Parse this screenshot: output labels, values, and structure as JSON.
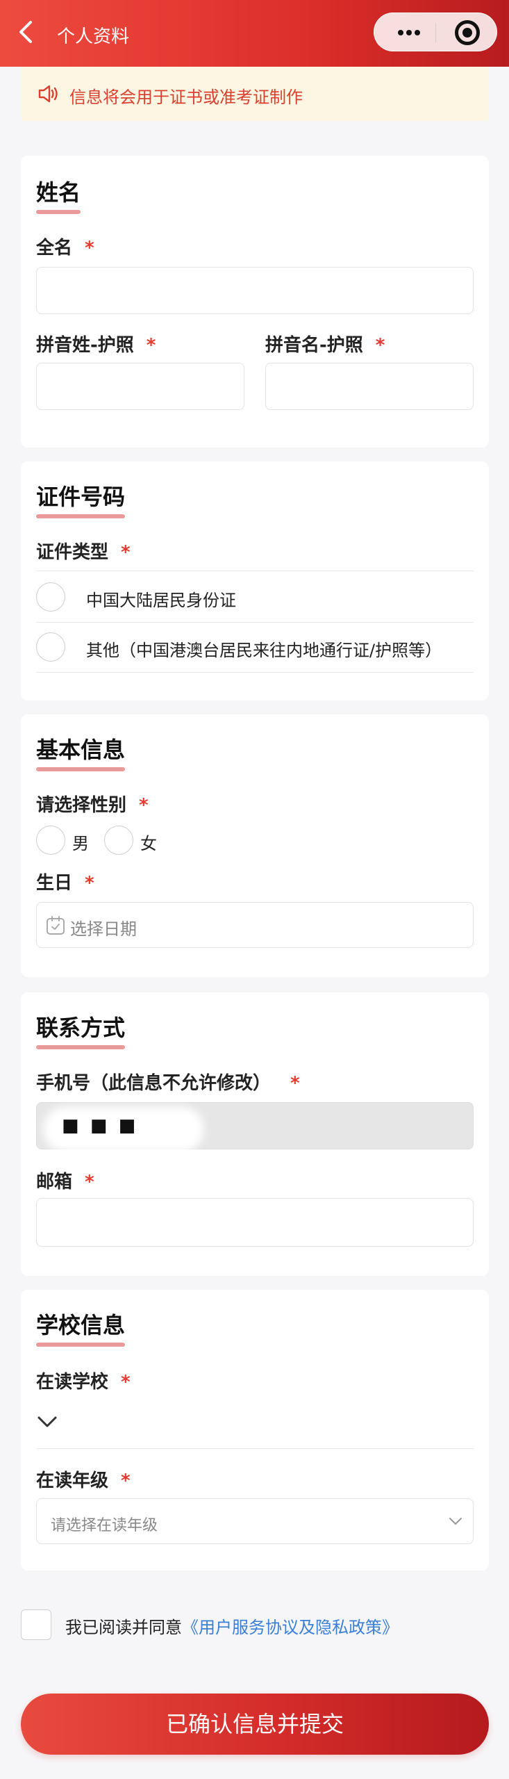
{
  "header": {
    "title": "个人资料"
  },
  "notice": {
    "text": "信息将会用于证书或准考证制作"
  },
  "name_section": {
    "title": "姓名",
    "full_name_label": "全名",
    "surname_label": "拼音姓-护照",
    "given_name_label": "拼音名-护照",
    "required_mark": "*"
  },
  "id_section": {
    "title": "证件号码",
    "type_label": "证件类型",
    "options": [
      "中国大陆居民身份证",
      "其他（中国港澳台居民来往内地通行证/护照等）"
    ]
  },
  "basic_section": {
    "title": "基本信息",
    "gender_label": "请选择性别",
    "gender_options": [
      "男",
      "女"
    ],
    "birthday_label": "生日",
    "birthday_placeholder": "选择日期"
  },
  "contact_section": {
    "title": "联系方式",
    "phone_label": "手机号（此信息不允许修改）",
    "phone_value": "■ ■ ■",
    "email_label": "邮箱"
  },
  "school_section": {
    "title": "学校信息",
    "school_label": "在读学校",
    "grade_label": "在读年级",
    "grade_placeholder": "请选择在读年级"
  },
  "agreement": {
    "prefix": "我已阅读并同意",
    "link": "《用户服务协议及隐私政策》"
  },
  "submit_label": "已确认信息并提交",
  "colors": {
    "primary_red": "#dc2f2a",
    "required_red": "#e33b30",
    "link_blue": "#3a7fd6",
    "notice_bg": "#fdf6e3"
  }
}
